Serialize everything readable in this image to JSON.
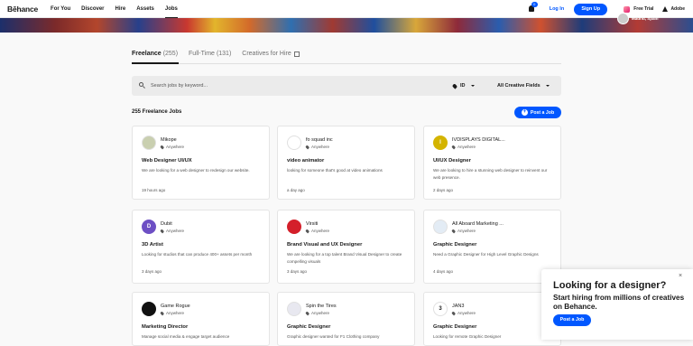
{
  "header": {
    "logo": "Bēhance",
    "nav": [
      "For You",
      "Discover",
      "Hire",
      "Assets",
      "Jobs"
    ],
    "active_nav": "Jobs",
    "notification_count": "0",
    "login": "Log In",
    "signup": "Sign Up",
    "free_trial": "Free Trial",
    "adobe": "Adobe"
  },
  "banner": {
    "location": "Madrid, Spain"
  },
  "tabs": [
    {
      "label": "Freelance",
      "count": "(255)"
    },
    {
      "label": "Full-Time",
      "count": "(131)"
    },
    {
      "label": "Creatives for Hire",
      "count": ""
    }
  ],
  "search": {
    "placeholder": "Search jobs by keyword...",
    "location_filter": "ID",
    "field_filter": "All Creative Fields"
  },
  "jobs_count": "255 Freelance Jobs",
  "post_job_label": "Post a Job",
  "jobs": [
    {
      "company": "Mikope",
      "location": "Anywhere",
      "title": "Web Designer UI/UX",
      "desc": "We are looking for a web designer to redesign our website.",
      "time": "19 hours ago",
      "logo_text": "",
      "logo_color": "#c9cfb0"
    },
    {
      "company": "fo squad inc",
      "location": "Anywhere",
      "title": "video animator",
      "desc": "looking for someone that's good at video animations",
      "time": "a day ago",
      "logo_text": "",
      "logo_color": "#ffffff"
    },
    {
      "company": "IVDISPLAYS DIGITAL...",
      "location": "Anywhere",
      "title": "UI/UX Designer",
      "desc": "We are looking to hire a stunning web designer to reinvent our web presence.",
      "time": "2 days ago",
      "logo_text": "I",
      "logo_color": "#d4b400"
    },
    {
      "company": "Dubit",
      "location": "Anywhere",
      "title": "3D Artist",
      "desc": "Looking for studios that can produce 400+ assets per month",
      "time": "3 days ago",
      "logo_text": "D",
      "logo_color": "#6d4fc4"
    },
    {
      "company": "Virsiti",
      "location": "Anywhere",
      "title": "Brand Visual and UX Designer",
      "desc": "We are looking for a top talent Brand Visual Designer to create compelling visuals",
      "time": "3 days ago",
      "logo_text": "",
      "logo_color": "#d41f2a"
    },
    {
      "company": "All Aboard Marketing ...",
      "location": "Anywhere",
      "title": "Graphic Designer",
      "desc": "Need a Graphic Designer for High Level Graphic Designs",
      "time": "4 days ago",
      "logo_text": "",
      "logo_color": "#e3ecf5"
    },
    {
      "company": "Game Rogue",
      "location": "Anywhere",
      "title": "Marketing Director",
      "desc": "Manage social media & engage target audience",
      "time": "",
      "logo_text": "",
      "logo_color": "#111111"
    },
    {
      "company": "Spin the Tires",
      "location": "Anywhere",
      "title": "Graphic Designer",
      "desc": "Graphic designer wanted for F1 Clothing company",
      "time": "",
      "logo_text": "",
      "logo_color": "#e8e8f0"
    },
    {
      "company": "JAN3",
      "location": "Anywhere",
      "title": "Graphic Designer",
      "desc": "Looking for remote Graphic Designer",
      "time": "",
      "logo_text": "3",
      "logo_color": "#ffffff"
    }
  ],
  "popup": {
    "title": "Looking for a designer?",
    "text": "Start hiring from millions of creatives on Behance.",
    "button": "Post a Job",
    "close": "×"
  },
  "colors": {
    "accent": "#0057ff"
  }
}
